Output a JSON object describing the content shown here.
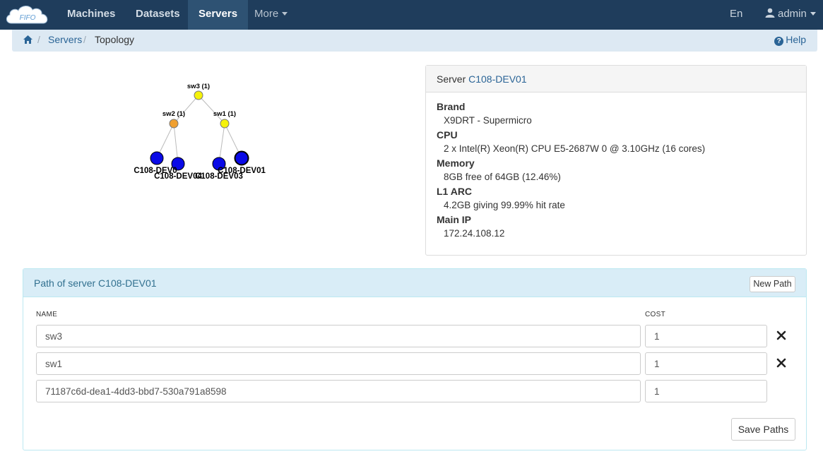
{
  "nav": {
    "logo_text": "FIFO",
    "items": [
      {
        "label": "Machines"
      },
      {
        "label": "Datasets"
      },
      {
        "label": "Servers"
      },
      {
        "label": "More"
      }
    ],
    "language": "En",
    "user": "admin"
  },
  "breadcrumb": {
    "items": [
      "Servers",
      "Topology"
    ],
    "help": "Help"
  },
  "topology": {
    "switches": [
      {
        "label": "sw3 (1)",
        "color": "#f5f20a"
      },
      {
        "label": "sw2 (1)",
        "color": "#f0a030"
      },
      {
        "label": "sw1 (1)",
        "color": "#f5f20a"
      }
    ],
    "servers": [
      "C108-DEV0",
      "C108-DEV04",
      "C108-DEV03",
      "C108-DEV01"
    ],
    "server_color": "#0a0ae6"
  },
  "server": {
    "title_prefix": "Server",
    "name": "C108-DEV01",
    "specs": [
      {
        "label": "Brand",
        "value": "X9DRT - Supermicro"
      },
      {
        "label": "CPU",
        "value": "2 x Intel(R) Xeon(R) CPU E5-2687W 0 @ 3.10GHz (16 cores)"
      },
      {
        "label": "Memory",
        "value": "8GB free of 64GB (12.46%)"
      },
      {
        "label": "L1 ARC",
        "value": "4.2GB giving 99.99% hit rate"
      },
      {
        "label": "Main IP",
        "value": "172.24.108.12"
      }
    ]
  },
  "path": {
    "title": "Path of server C108-DEV01",
    "new_path_label": "New Path",
    "name_header": "NAME",
    "cost_header": "COST",
    "rows": [
      {
        "name": "sw3",
        "cost": "1",
        "removable": true
      },
      {
        "name": "sw1",
        "cost": "1",
        "removable": true
      },
      {
        "name": "71187c6d-dea1-4dd3-bbd7-530a791a8598",
        "cost": "1",
        "removable": false
      }
    ],
    "save_label": "Save Paths"
  }
}
